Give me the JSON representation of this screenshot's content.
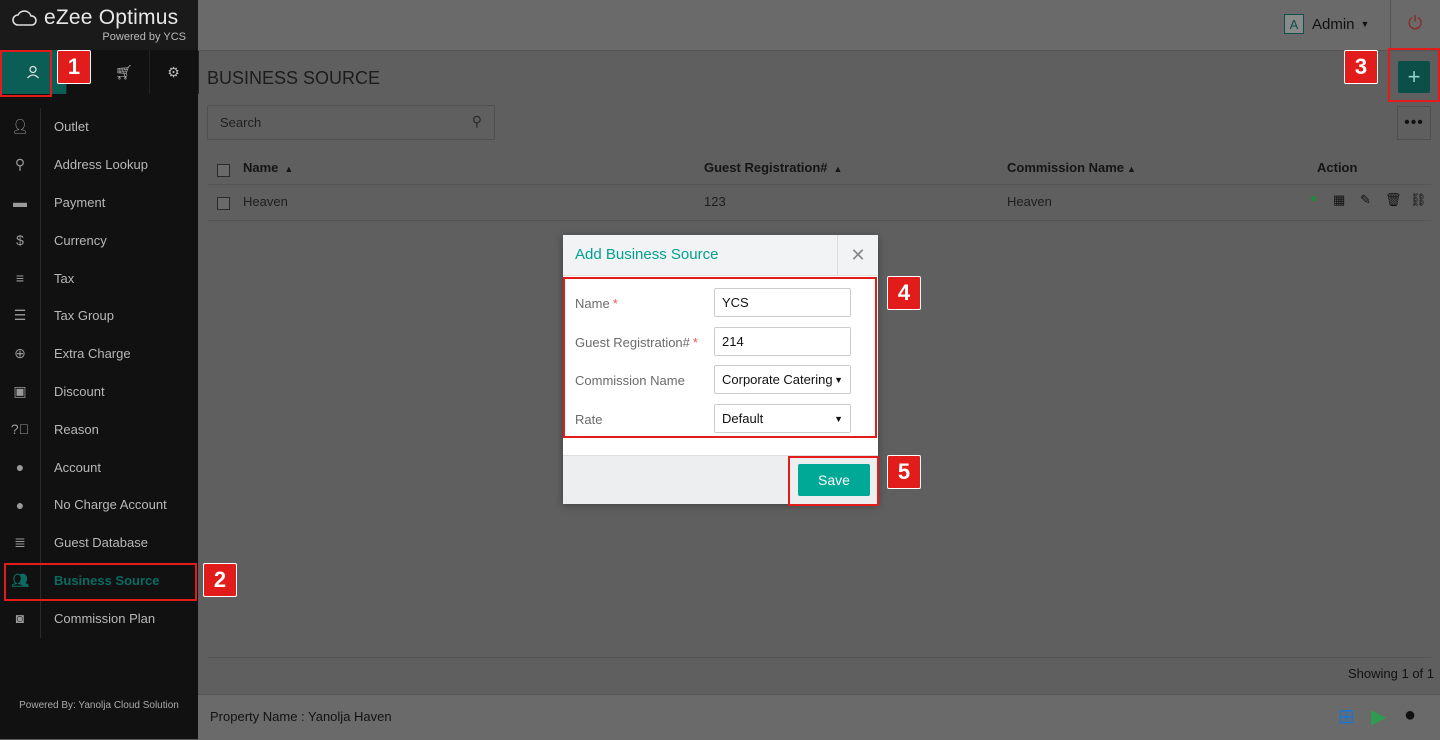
{
  "brand": {
    "name": "eZee Optimus",
    "sub": "Powered by YCS"
  },
  "sidebar": {
    "top_icons": [
      "user-icon",
      "cart-icon",
      "gear-icon"
    ],
    "items": [
      {
        "label": "Outlet",
        "icon": "user-icon"
      },
      {
        "label": "Address Lookup",
        "icon": "location-icon"
      },
      {
        "label": "Payment",
        "icon": "card-icon"
      },
      {
        "label": "Currency",
        "icon": "dollar-icon"
      },
      {
        "label": "Tax",
        "icon": "bars-icon"
      },
      {
        "label": "Tax Group",
        "icon": "list-icon"
      },
      {
        "label": "Extra Charge",
        "icon": "plus-circle-icon"
      },
      {
        "label": "Discount",
        "icon": "gift-icon"
      },
      {
        "label": "Reason",
        "icon": "question-icon"
      },
      {
        "label": "Account",
        "icon": "person-icon"
      },
      {
        "label": "No Charge Account",
        "icon": "person-icon"
      },
      {
        "label": "Guest Database",
        "icon": "database-icon"
      },
      {
        "label": "Business Source",
        "icon": "users-icon",
        "active": true
      },
      {
        "label": "Commission Plan",
        "icon": "money-icon"
      }
    ],
    "powered_by": "Powered By: Yanolja Cloud Solution"
  },
  "header": {
    "user_initial": "A",
    "user_name": "Admin"
  },
  "page": {
    "title": "BUSINESS SOURCE",
    "search_placeholder": "Search",
    "columns": {
      "name": "Name",
      "guest_reg": "Guest Registration#",
      "commission": "Commission Name",
      "action": "Action"
    },
    "rows": [
      {
        "name": "Heaven",
        "guest_reg": "123",
        "commission": "Heaven"
      }
    ],
    "showing": "Showing 1 of 1",
    "property": "Property Name : Yanolja Haven"
  },
  "modal": {
    "title": "Add Business Source",
    "fields": {
      "name_label": "Name",
      "name_value": "YCS",
      "guest_label": "Guest Registration#",
      "guest_value": "214",
      "commission_label": "Commission Name",
      "commission_value": "Corporate Catering",
      "rate_label": "Rate",
      "rate_value": "Default"
    },
    "required_mark": "*",
    "save_label": "Save"
  },
  "annotations": [
    "1",
    "2",
    "3",
    "4",
    "5"
  ],
  "colors": {
    "accent": "#00a896",
    "dark_teal": "#0b4f48",
    "annotation_red": "#e21b1b"
  }
}
